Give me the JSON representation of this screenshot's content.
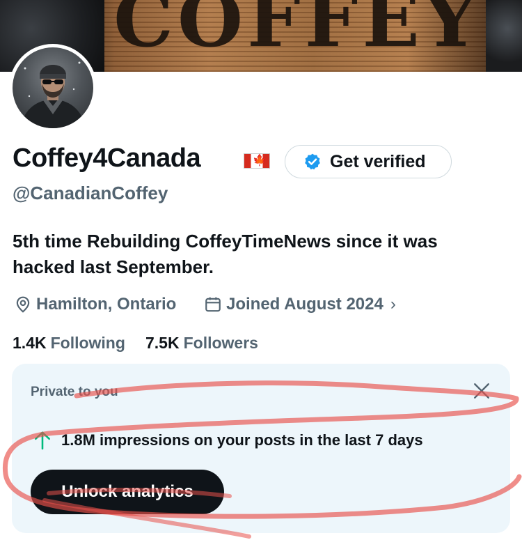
{
  "banner": {
    "text": "COFFEY"
  },
  "profile": {
    "display_name": "Coffey4Canada",
    "flag_glyph": "🍁",
    "handle": "@CanadianCoffey",
    "verify_button": "Get verified",
    "bio": "5th time Rebuilding CoffeyTimeNews since it was hacked last September.",
    "location": "Hamilton, Ontario",
    "joined": "Joined August 2024",
    "joined_chevron": "›",
    "following_count": "1.4K",
    "following_label": "Following",
    "followers_count": "7.5K",
    "followers_label": "Followers"
  },
  "analytics_card": {
    "private_label": "Private to you",
    "impressions_text": "1.8M impressions on your posts in the last 7 days",
    "unlock_button": "Unlock analytics"
  },
  "icons": {
    "verified": "verified-badge-icon",
    "location": "location-pin-icon",
    "calendar": "calendar-icon",
    "trend": "arrow-up-icon",
    "close": "close-icon"
  },
  "colors": {
    "text": "#0f1419",
    "muted": "#536471",
    "verified_blue": "#1d9bf0",
    "card_bg": "#edf6fb",
    "trend_green": "#00ba7c",
    "scribble_red": "#e8504a"
  }
}
